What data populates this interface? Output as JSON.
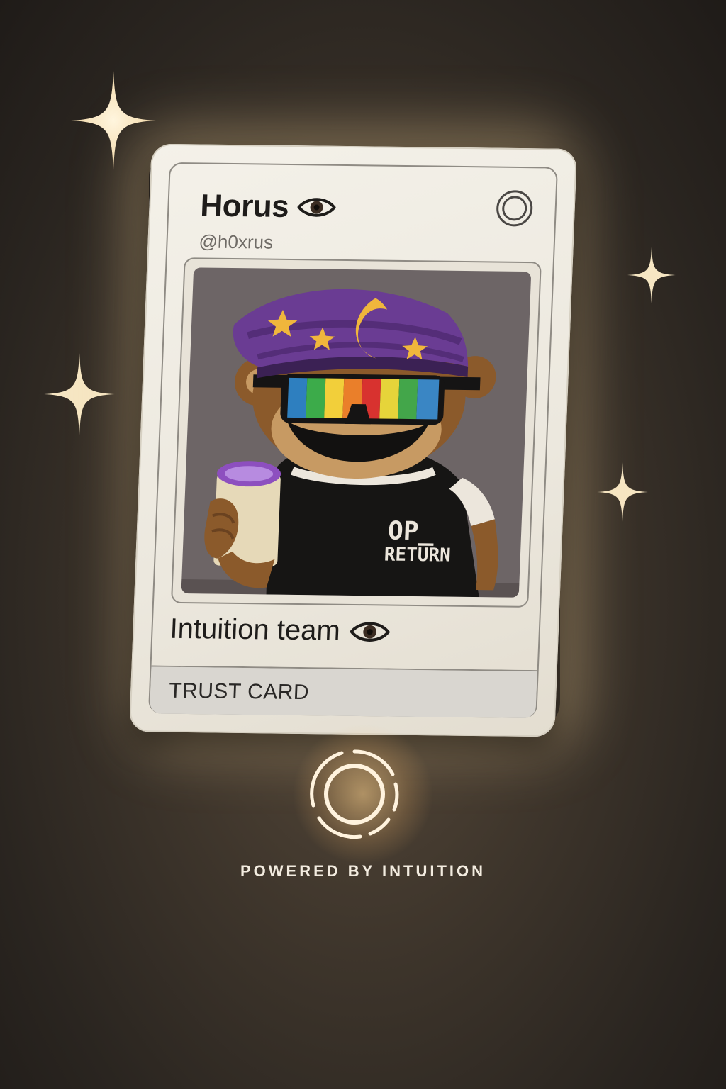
{
  "card": {
    "name": "Horus",
    "handle": "@h0xrus",
    "team": "Intuition team",
    "footer_label": "TRUST CARD",
    "artwork": {
      "description_icon": "monkey-avatar",
      "shirt_text_line1": "OP_",
      "shirt_text_line2": "RETURN"
    }
  },
  "branding": {
    "powered_by": "POWERED BY INTUITION",
    "logo_icon": "intuition-ring-icon"
  },
  "colors": {
    "background": "#2f2823",
    "card": "#f0ece3",
    "accent_glow": "#ffd59a",
    "hat_purple": "#6a3c93",
    "star_yellow": "#f0b63c"
  }
}
